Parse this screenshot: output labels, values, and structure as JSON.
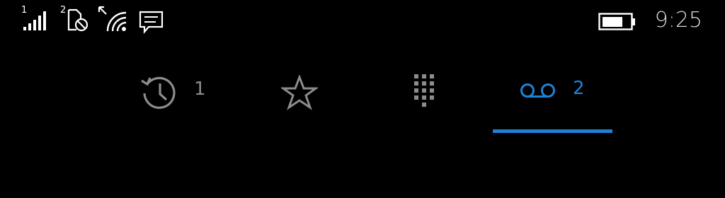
{
  "status_bar": {
    "sim1_label": "1",
    "sim2_label": "2",
    "time": "9:25",
    "icons": [
      "signal-icon",
      "sim-no-service-icon",
      "wifi-icon",
      "message-icon",
      "battery-icon"
    ]
  },
  "tabs": [
    {
      "id": "history",
      "icon": "history-icon",
      "count": "1",
      "selected": false
    },
    {
      "id": "favorites",
      "icon": "star-icon",
      "count": "",
      "selected": false
    },
    {
      "id": "dialpad",
      "icon": "dialpad-icon",
      "count": "",
      "selected": false
    },
    {
      "id": "voicemail",
      "icon": "voicemail-icon",
      "count": "2",
      "selected": true
    }
  ],
  "colors": {
    "background": "#000000",
    "accent": "#1e82d7",
    "inactive_icon": "#8c8c8c",
    "status_text": "#d9d9d9"
  }
}
